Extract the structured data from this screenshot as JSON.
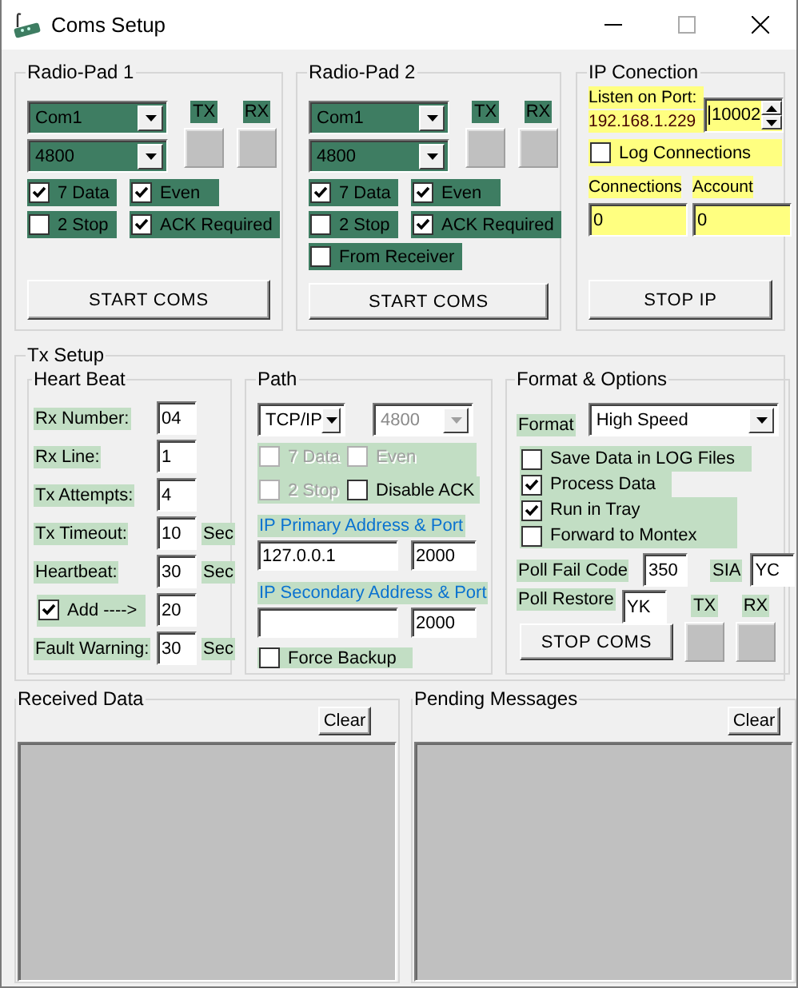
{
  "window": {
    "title": "Coms Setup"
  },
  "radio_pads": [
    {
      "title": "Radio-Pad 1",
      "port": "Com1",
      "baud": "4800",
      "tx_label": "TX",
      "rx_label": "RX",
      "options": [
        {
          "label": "7 Data",
          "checked": true
        },
        {
          "label": "Even",
          "checked": true
        },
        {
          "label": "2 Stop",
          "checked": false
        },
        {
          "label": "ACK Required",
          "checked": true
        }
      ],
      "button": "START COMS"
    },
    {
      "title": "Radio-Pad 2",
      "port": "Com1",
      "baud": "4800",
      "tx_label": "TX",
      "rx_label": "RX",
      "options": [
        {
          "label": "7 Data",
          "checked": true
        },
        {
          "label": "Even",
          "checked": true
        },
        {
          "label": "2 Stop",
          "checked": false
        },
        {
          "label": "ACK Required",
          "checked": true
        },
        {
          "label": "From Receiver",
          "checked": false
        }
      ],
      "button": "START COMS"
    }
  ],
  "ip_connection": {
    "title": "IP Conection",
    "listen_label": "Listen on Port:",
    "address": "192.168.1.229",
    "port": "10002",
    "log_connections": {
      "label": "Log Connections",
      "checked": false
    },
    "connections_label": "Connections",
    "connections": "0",
    "account_label": "Account",
    "account": "0",
    "button": "STOP IP"
  },
  "tx_setup": {
    "title": "Tx Setup",
    "heart_beat": {
      "title": "Heart Beat",
      "rows": [
        {
          "kind": "field",
          "label": "Rx Number:",
          "value": "04"
        },
        {
          "kind": "field",
          "label": "Rx Line:",
          "value": "1"
        },
        {
          "kind": "field",
          "label": "Tx Attempts:",
          "value": "4"
        },
        {
          "kind": "field",
          "label": "Tx Timeout:",
          "value": "10",
          "unit": "Sec"
        },
        {
          "kind": "field",
          "label": "Heartbeat:",
          "value": "30",
          "unit": "Sec"
        },
        {
          "kind": "checkbox",
          "label": "Add ---->",
          "checked": true,
          "value": "20"
        },
        {
          "kind": "field",
          "label": "Fault Warning:",
          "value": "30",
          "unit": "Sec"
        }
      ]
    },
    "path": {
      "title": "Path",
      "protocol": "TCP/IP",
      "baud": {
        "value": "4800",
        "disabled": true
      },
      "options": [
        {
          "label": "7 Data",
          "checked": false,
          "disabled": true
        },
        {
          "label": "Even",
          "checked": false,
          "disabled": true
        },
        {
          "label": "2 Stop",
          "checked": false,
          "disabled": true
        },
        {
          "label": "Disable ACK",
          "checked": false,
          "disabled": false
        }
      ],
      "primary_label": "IP Primary Address & Port",
      "primary_address": "127.0.0.1",
      "primary_port": "2000",
      "secondary_label": "IP Secondary Address & Port",
      "secondary_port": "2000",
      "force_backup": {
        "label": "Force Backup",
        "checked": false
      }
    },
    "format_options": {
      "title": "Format & Options",
      "format_label": "Format",
      "format": "High Speed",
      "options": [
        {
          "label": "Save Data in LOG Files",
          "checked": false
        },
        {
          "label": "Process Data",
          "checked": true
        },
        {
          "label": "Run in Tray",
          "checked": true
        },
        {
          "label": "Forward to Montex",
          "checked": false
        }
      ],
      "poll_fail_label": "Poll Fail Code",
      "poll_fail_code": "350",
      "sia_label": "SIA",
      "sia": "YC",
      "poll_restore_label": "Poll Restore",
      "poll_restore": "YK",
      "button": "STOP COMS",
      "tx_label": "TX",
      "rx_label": "RX"
    }
  },
  "received": {
    "title": "Received Data",
    "button": "Clear"
  },
  "pending": {
    "title": "Pending Messages",
    "button": "Clear"
  }
}
